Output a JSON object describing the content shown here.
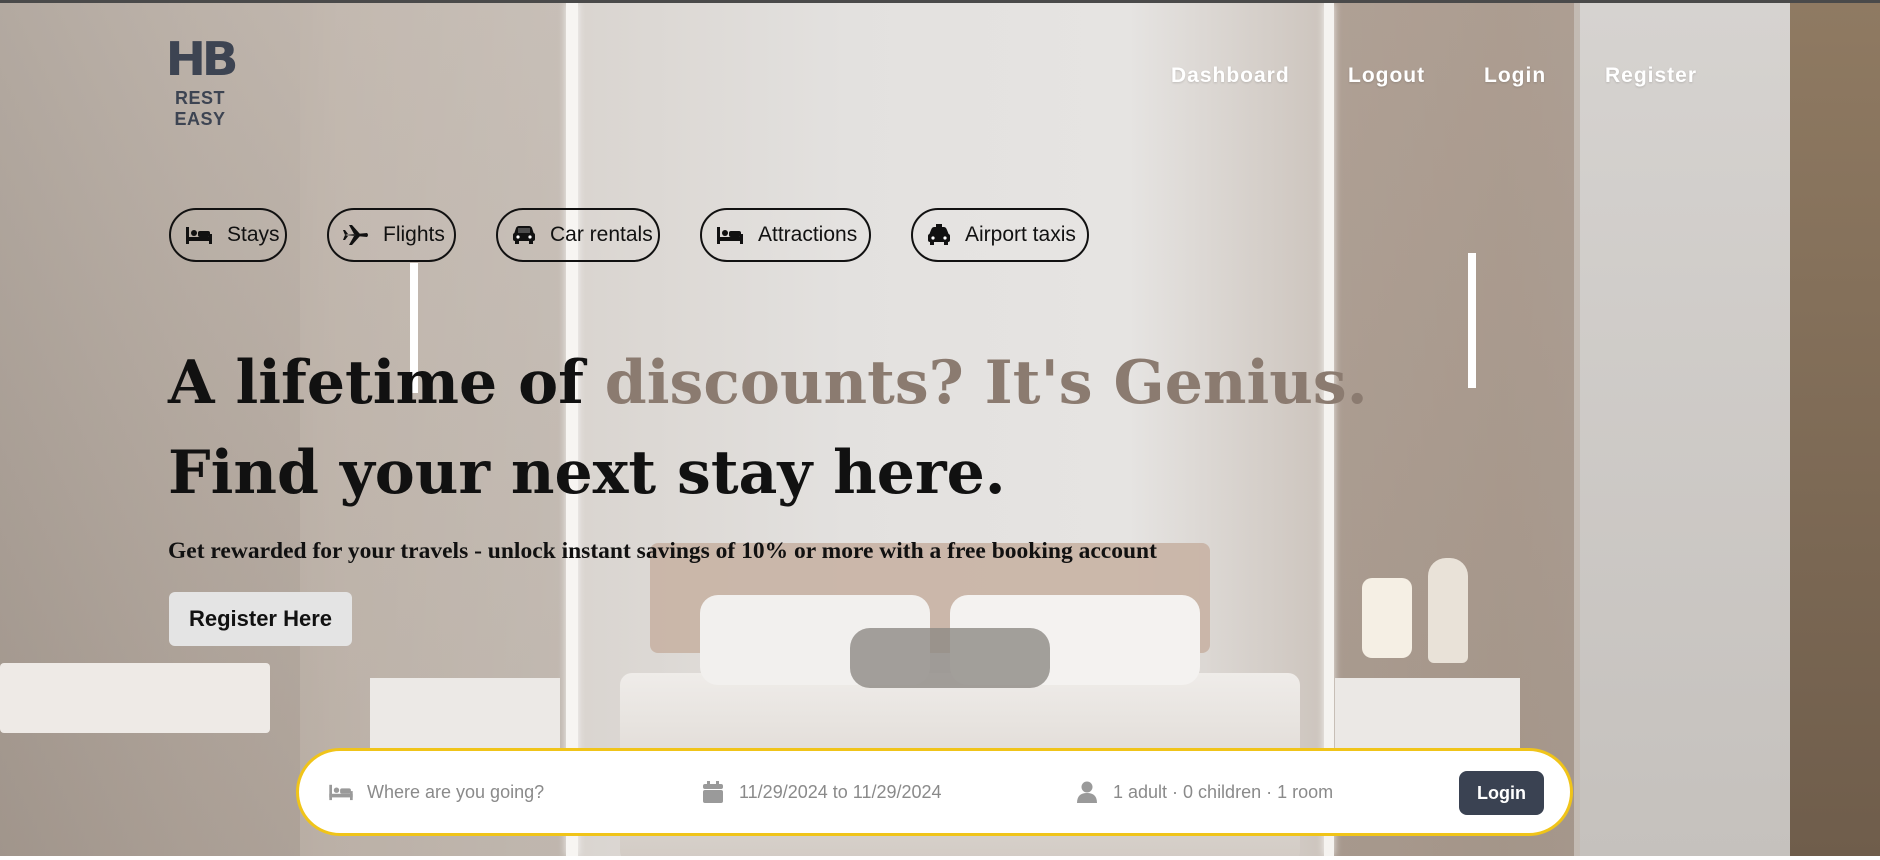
{
  "brand": {
    "logo_mark": "HB",
    "name": "REST EASY"
  },
  "nav": {
    "links": [
      "Dashboard",
      "Logout",
      "Login",
      "Register"
    ]
  },
  "categories": [
    {
      "label": "Stays",
      "icon": "bed-icon"
    },
    {
      "label": "Flights",
      "icon": "plane-icon"
    },
    {
      "label": "Car rentals",
      "icon": "car-icon"
    },
    {
      "label": "Attractions",
      "icon": "bed-icon"
    },
    {
      "label": "Airport taxis",
      "icon": "taxi-icon"
    }
  ],
  "hero": {
    "headline_part1": "A lifetime of ",
    "headline_accent": "discounts? It's Genius.",
    "headline_line2": "Find your next stay here.",
    "subline": "Get rewarded for your travels - unlock instant savings of 10% or more with a free booking account",
    "register_button": "Register Here"
  },
  "search": {
    "destination_placeholder": "Where are you going?",
    "dates": "11/29/2024 to 11/29/2024",
    "guests": "1 adult · 0 children · 1 room",
    "submit_label": "Login"
  },
  "colors": {
    "accent_text": "#8b7b70",
    "search_border": "#f0c419",
    "button_dark": "#3a4252",
    "logo": "#3d4452"
  }
}
